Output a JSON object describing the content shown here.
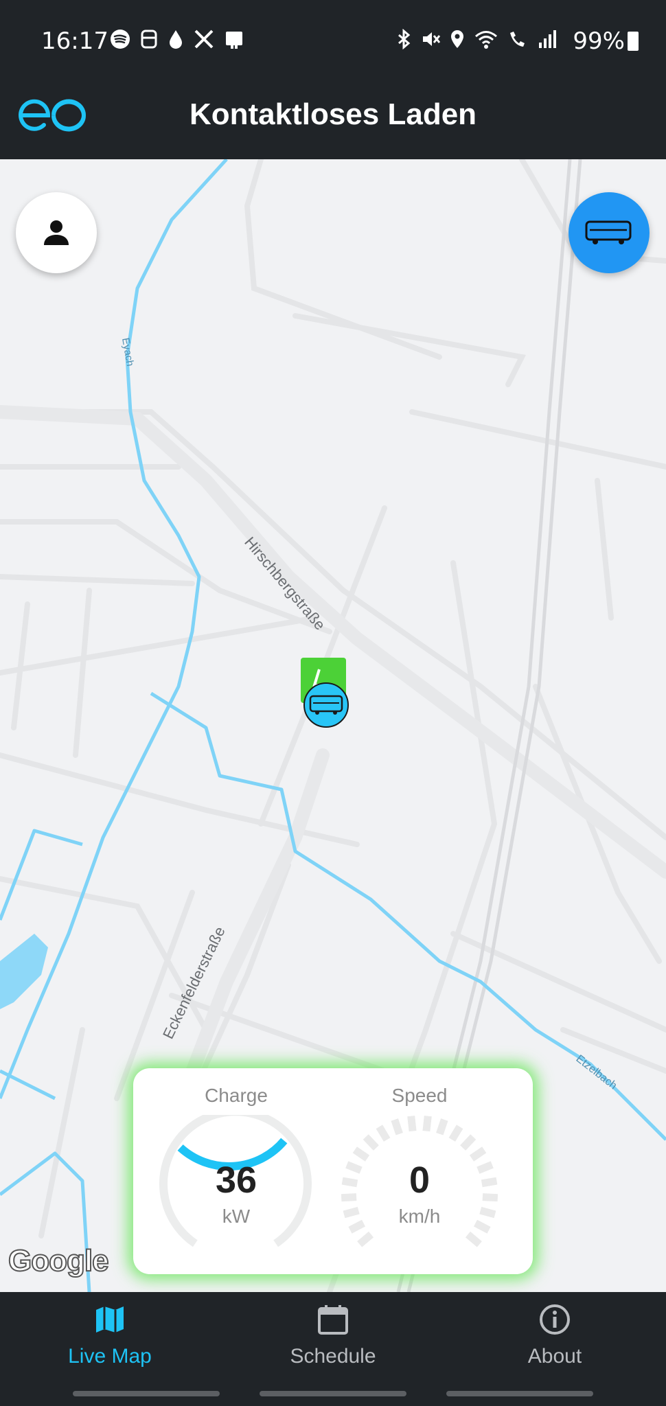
{
  "status_bar": {
    "time": "16:17",
    "battery": "99%",
    "icons_left": [
      "spotify-icon",
      "notification-icon",
      "drop-icon",
      "x-icon",
      "device-icon"
    ],
    "icons_right": [
      "bluetooth-icon",
      "mute-icon",
      "location-icon",
      "wifi-icon",
      "wifi-call-icon",
      "signal-icon",
      "battery-icon"
    ]
  },
  "app_bar": {
    "title": "Kontaktloses Laden",
    "logo": "eo"
  },
  "map": {
    "street_labels": [
      "Hirschbergstraße",
      "Eckenfelderstraße",
      "Eyach",
      "Etzelbach"
    ],
    "attribution": "Google",
    "water_color": "#7fd3f7",
    "charger_color": "#4cd137",
    "bus_marker_color": "#29c5f6"
  },
  "gauges": {
    "charge": {
      "label": "Charge",
      "value": "36",
      "unit": "kW",
      "fill_fraction": 0.33,
      "color": "#1ec3f5"
    },
    "speed": {
      "label": "Speed",
      "value": "0",
      "unit": "km/h"
    }
  },
  "nav": {
    "items": [
      {
        "label": "Live Map",
        "active": true
      },
      {
        "label": "Schedule",
        "active": false
      },
      {
        "label": "About",
        "active": false
      }
    ],
    "active_color": "#1ec3f5",
    "inactive_color": "#b9bcc0"
  }
}
